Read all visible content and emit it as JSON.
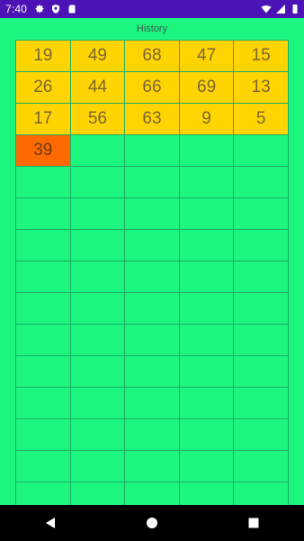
{
  "status_bar": {
    "time": "7:40",
    "left_icons": [
      "gear-icon",
      "shield-icon",
      "sd-card-icon"
    ],
    "right_icons": [
      "wifi-icon",
      "signal-icon",
      "battery-icon"
    ]
  },
  "screen": {
    "title": "History"
  },
  "history": {
    "rows": [
      [
        "19",
        "49",
        "68",
        "47",
        "15"
      ],
      [
        "26",
        "44",
        "66",
        "69",
        "13"
      ],
      [
        "17",
        "56",
        "63",
        "9",
        "5"
      ],
      [
        "39",
        "",
        "",
        "",
        ""
      ]
    ],
    "current_cell": {
      "row": 3,
      "col": 0
    },
    "empty_rows": 11,
    "colors": {
      "filled": "#ffd400",
      "current": "#ff6a00",
      "background": "#1cf57e",
      "grid_line": "#1fae61"
    }
  },
  "nav_bar": {
    "buttons": [
      "back-icon",
      "home-icon",
      "recents-icon"
    ]
  }
}
